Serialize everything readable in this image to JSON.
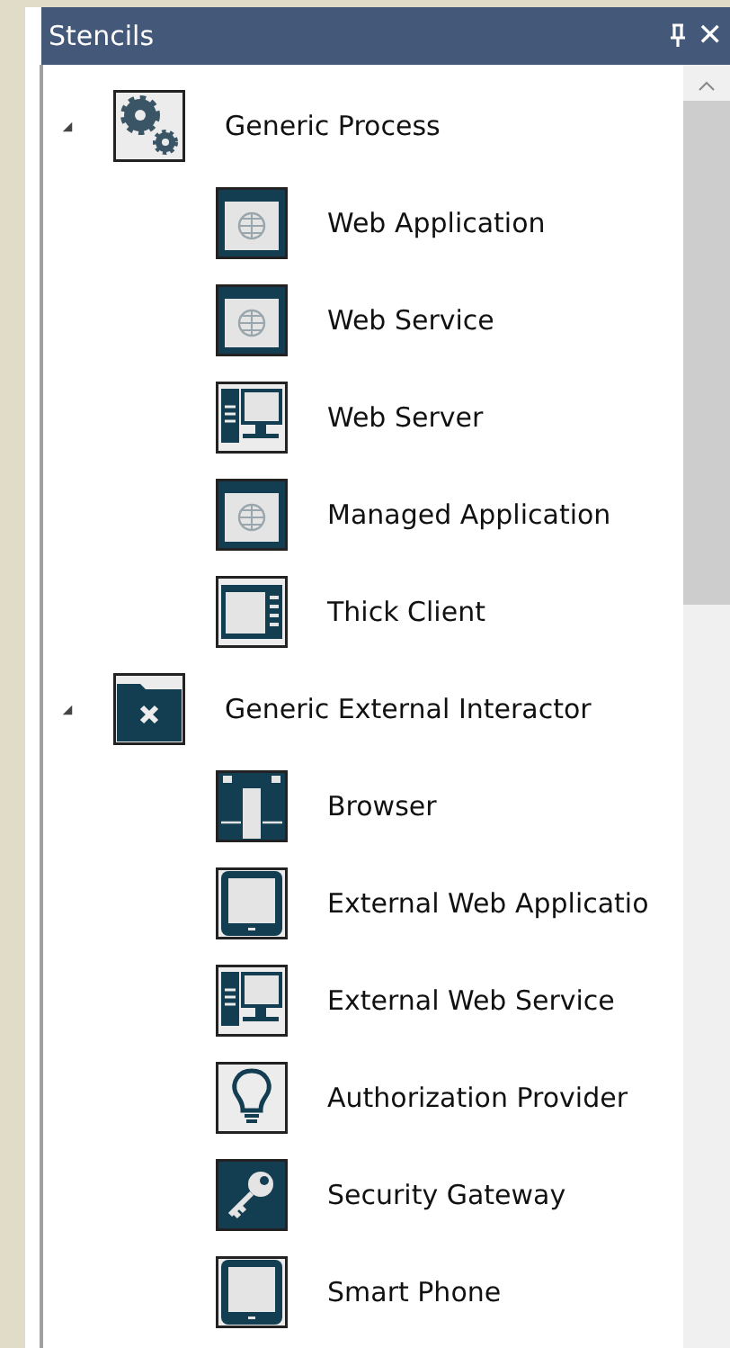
{
  "panel": {
    "title": "Stencils",
    "close_glyph": "✕"
  },
  "groups": [
    {
      "label": "Generic Process",
      "kind": "gears",
      "expanded": true,
      "children": [
        {
          "label": "Web Application",
          "kind": "window"
        },
        {
          "label": "Web Service",
          "kind": "window"
        },
        {
          "label": "Web Server",
          "kind": "server"
        },
        {
          "label": "Managed Application",
          "kind": "window"
        },
        {
          "label": "Thick Client",
          "kind": "client"
        }
      ]
    },
    {
      "label": "Generic External Interactor",
      "kind": "folder",
      "expanded": true,
      "children": [
        {
          "label": "Browser",
          "kind": "binoculars"
        },
        {
          "label": "External Web Applicatio",
          "kind": "tablet"
        },
        {
          "label": "External Web Service",
          "kind": "server"
        },
        {
          "label": "Authorization Provider",
          "kind": "bulb"
        },
        {
          "label": "Security Gateway",
          "kind": "key"
        },
        {
          "label": "Smart Phone",
          "kind": "tablet"
        }
      ]
    }
  ]
}
